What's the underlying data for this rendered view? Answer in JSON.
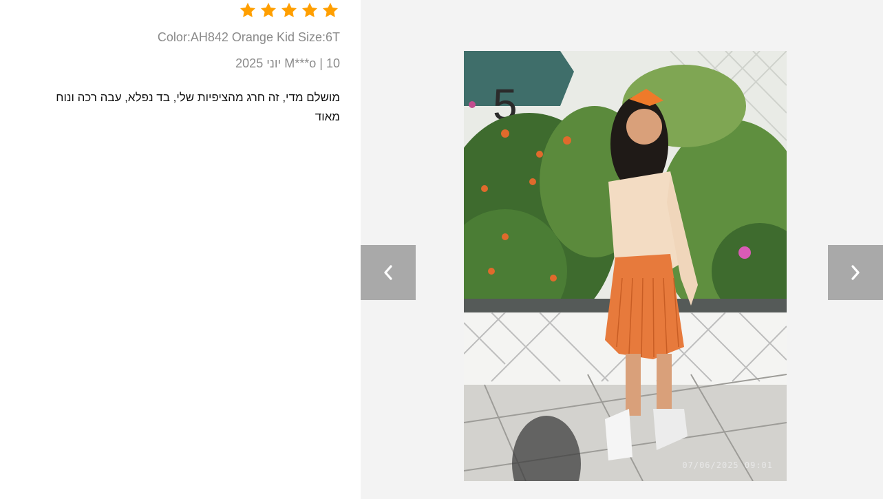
{
  "review": {
    "rating": 5,
    "sku": "Color:AH842 Orange Kid Size:6T",
    "meta": "10 | M***o יוני 2025",
    "text": "מושלם מדי, זה חרג מהציפיות שלי, בד נפלא, עבה רכה ונוח מאוד"
  },
  "gallery": {
    "photo_timestamp": "07/06/2025  09:01",
    "prev_icon": "chevron-left-icon",
    "next_icon": "chevron-right-icon"
  },
  "colors": {
    "star": "#FF9F00",
    "nav_button": "#A9A9A9",
    "gallery_bg": "#F3F3F3"
  }
}
